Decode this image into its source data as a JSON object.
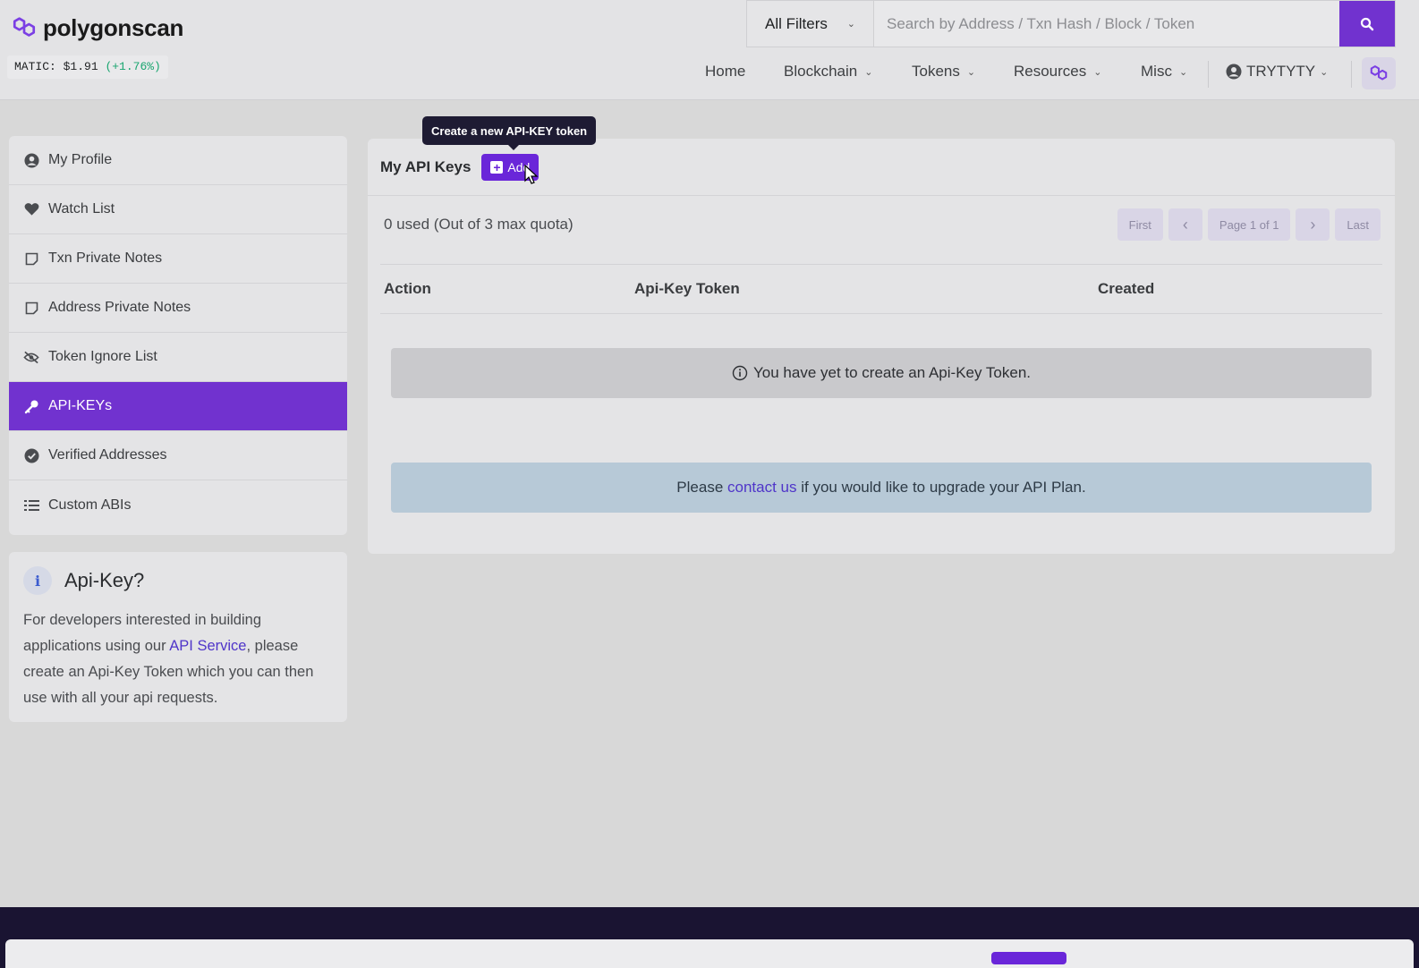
{
  "brand": {
    "name": "polygonscan",
    "price_label": "MATIC: $1.91",
    "price_change": "(+1.76%)"
  },
  "search": {
    "filter_label": "All Filters",
    "placeholder": "Search by Address / Txn Hash / Block / Token"
  },
  "nav": {
    "home": "Home",
    "blockchain": "Blockchain",
    "tokens": "Tokens",
    "resources": "Resources",
    "misc": "Misc",
    "user": "TRYTYTY"
  },
  "sidebar": {
    "items": [
      {
        "label": "My Profile",
        "icon": "user-circle-icon"
      },
      {
        "label": "Watch List",
        "icon": "heart-icon"
      },
      {
        "label": "Txn Private Notes",
        "icon": "note-icon"
      },
      {
        "label": "Address Private Notes",
        "icon": "note-icon"
      },
      {
        "label": "Token Ignore List",
        "icon": "eye-slash-icon"
      },
      {
        "label": "API-KEYs",
        "icon": "key-icon",
        "active": true
      },
      {
        "label": "Verified Addresses",
        "icon": "check-badge-icon"
      },
      {
        "label": "Custom ABIs",
        "icon": "list-icon"
      }
    ]
  },
  "info": {
    "title": "Api-Key?",
    "text_1": "For developers interested in building applications using our ",
    "link": "API Service",
    "text_2": ", please create an Api-Key Token which you can then use with all your api requests."
  },
  "main": {
    "title": "My API Keys",
    "add_label": "Add",
    "tooltip": "Create a new API-KEY token",
    "quota": "0 used (Out of 3 max quota)",
    "pager": {
      "first": "First",
      "prev": "‹",
      "page": "Page 1 of 1",
      "next": "›",
      "last": "Last"
    },
    "columns": [
      "Action",
      "Api-Key Token",
      "Created"
    ],
    "empty_message": "You have yet to create an Api-Key Token.",
    "upgrade_prefix": "Please ",
    "upgrade_link": "contact us",
    "upgrade_suffix": " if you would like to upgrade your API Plan."
  },
  "colors": {
    "accent": "#7132cf",
    "positive": "#19a56f",
    "link": "#4f35c9"
  }
}
